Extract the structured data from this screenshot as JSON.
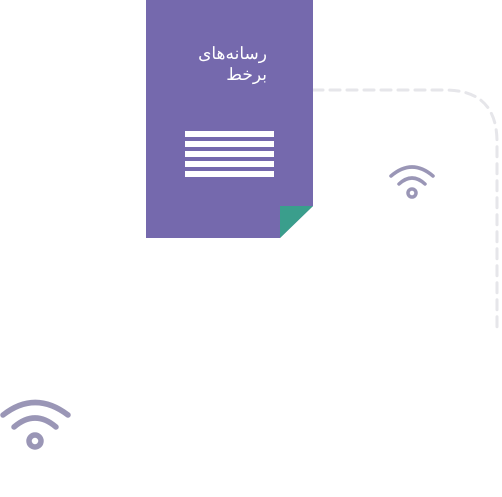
{
  "document_card": {
    "title": "رسانه‌های\nبرخط",
    "color": "#7569ad",
    "fold_color": "#3a9e8c",
    "line_count": 5
  },
  "icons": {
    "small": "wifi-icon",
    "large": "wifi-icon",
    "icon_color": "#9a96b6"
  },
  "connector": {
    "style": "dashed",
    "color": "#e6e6ea"
  }
}
